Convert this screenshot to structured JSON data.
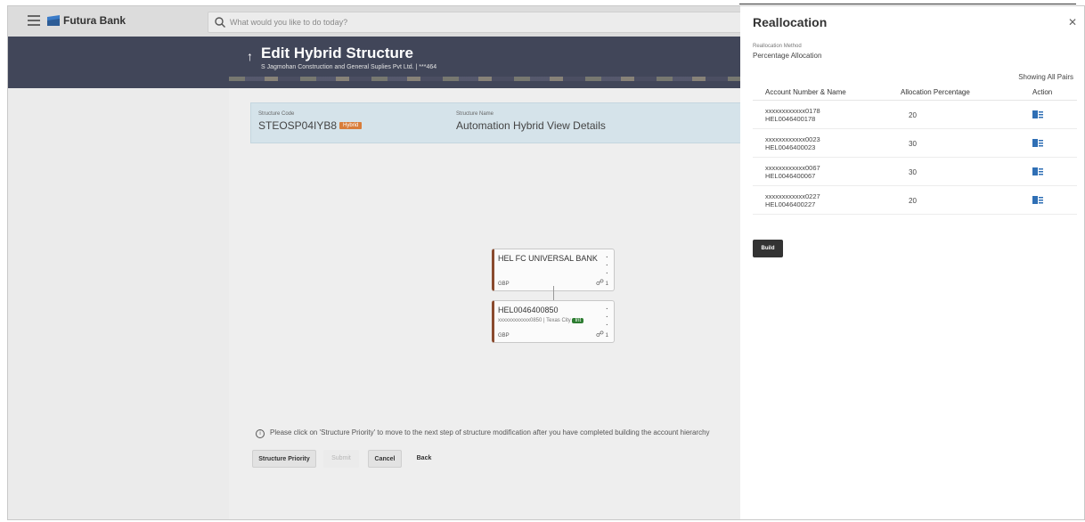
{
  "header": {
    "brand": "Futura Bank",
    "search_placeholder": "What would you like to do today?"
  },
  "page": {
    "title": "Edit Hybrid Structure",
    "subtitle": "S Jagmohan Construction and General Suplies Pvt Ltd. | ***464"
  },
  "structure": {
    "code_label": "Structure Code",
    "code_value": "STEOSP04IYB8",
    "code_badge": "Hybrid",
    "name_label": "Structure Name",
    "name_value": "Automation Hybrid View Details"
  },
  "hierarchy": {
    "root": {
      "title": "HEL FC UNIVERSAL BANK",
      "currency": "GBP",
      "children": "1"
    },
    "child": {
      "title": "HEL0046400850",
      "sub": "xxxxxxxxxxxx0850 | Texas City",
      "badge": "Int",
      "currency": "GBP",
      "children": "1"
    }
  },
  "info_message": "Please click on 'Structure Priority' to move to the next step of structure modification after you have completed building the account hierarchy",
  "actions": {
    "priority": "Structure Priority",
    "submit": "Submit",
    "cancel": "Cancel",
    "back": "Back"
  },
  "drawer": {
    "title": "Reallocation",
    "method_label": "Reallocation Method",
    "method_value": "Percentage Allocation",
    "showing": "Showing All Pairs",
    "columns": [
      "Account Number & Name",
      "Allocation Percentage",
      "Action"
    ],
    "rows": [
      {
        "number": "xxxxxxxxxxxx0178",
        "name": "HEL0046400178",
        "pct": "20"
      },
      {
        "number": "xxxxxxxxxxxx0023",
        "name": "HEL0046400023",
        "pct": "30"
      },
      {
        "number": "xxxxxxxxxxxx0067",
        "name": "HEL0046400067",
        "pct": "30"
      },
      {
        "number": "xxxxxxxxxxxx0227",
        "name": "HEL0046400227",
        "pct": "20"
      }
    ],
    "build": "Build"
  },
  "colors": {
    "band": "#414659",
    "accent_node": "#8a4b2e",
    "hybrid_badge": "#d87d3a",
    "int_badge": "#2e7d32",
    "action_icon": "#2f6fb5"
  }
}
